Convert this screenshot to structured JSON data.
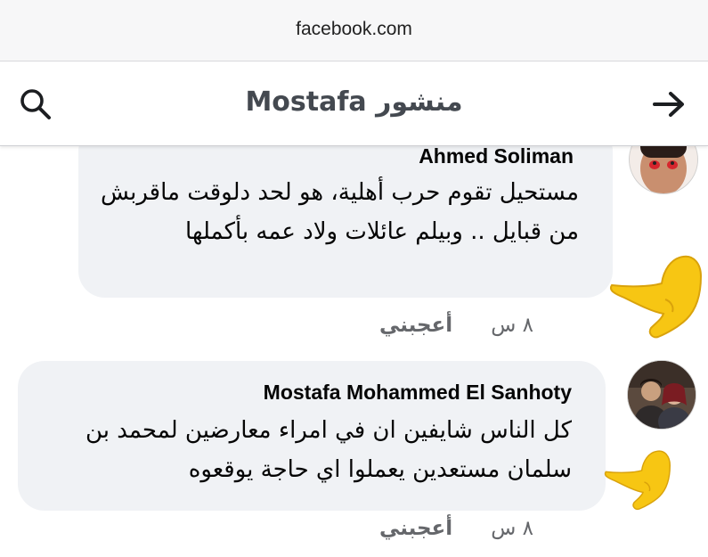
{
  "browser": {
    "url": "facebook.com"
  },
  "header": {
    "title": "منشور Mostafa"
  },
  "comments": [
    {
      "author": "Ahmed Soliman",
      "text": "مستحيل تقوم حرب أهلية، هو لحد دلوقت ماقربش من قبايل .. وبيلم عائلات ولاد عمه بأكملها",
      "time": "٨ س",
      "like_label": "أعجبني"
    },
    {
      "author": "Mostafa Mohammed El Sanhoty",
      "text": "كل الناس شايفين ان في امراء معارضين لمحمد بن سلمان مستعدين يعملوا اي حاجة يوقعوه",
      "time": "٨ س",
      "like_label": "أعجبني"
    }
  ],
  "icons": {
    "search": "search-icon",
    "back": "arrow-right-icon",
    "pointer": "backhand-index-pointing-left-emoji"
  },
  "colors": {
    "bubble": "#f0f2f5",
    "secondary_text": "#65676b",
    "emoji_yellow": "#f7c613"
  }
}
